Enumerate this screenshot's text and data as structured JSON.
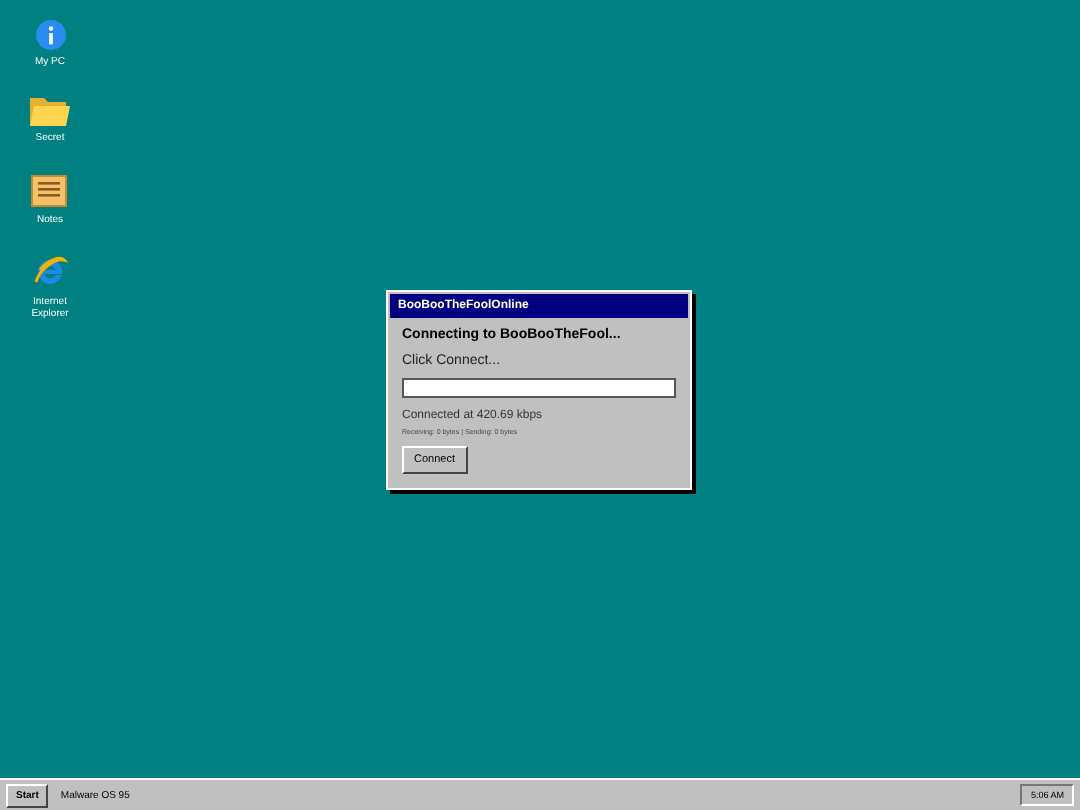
{
  "desktop_icons": [
    {
      "kind": "info",
      "label": "My PC"
    },
    {
      "kind": "folder",
      "label": "Secret"
    },
    {
      "kind": "notes",
      "label": "Notes"
    },
    {
      "kind": "browser",
      "label": "Internet Explorer"
    }
  ],
  "dialog": {
    "title": "BooBooTheFoolOnline",
    "heading": "Connecting to BooBooTheFool...",
    "prompt": "Click Connect...",
    "speed": "Connected at 420.69 kbps",
    "stats": "Receiving: 0 bytes | Sending: 0 bytes",
    "button": "Connect"
  },
  "taskbar": {
    "start": "Start",
    "label": "Malware OS 95",
    "clock": "5:06 AM"
  }
}
